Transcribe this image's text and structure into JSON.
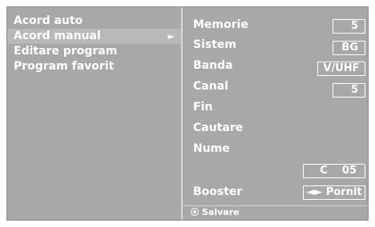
{
  "left_menu": {
    "items": [
      {
        "label": "Acord auto"
      },
      {
        "label": "Acord manual",
        "selected": true,
        "arrow": "►"
      },
      {
        "label": "Editare program"
      },
      {
        "label": "Program favorit"
      }
    ]
  },
  "settings": {
    "memorie": {
      "label": "Memorie",
      "value": "5"
    },
    "sistem": {
      "label": "Sistem",
      "value": "BG"
    },
    "banda": {
      "label": "Banda",
      "value": "V/UHF"
    },
    "canal": {
      "label": "Canal",
      "value": "5"
    },
    "fin": {
      "label": "Fin"
    },
    "cautare": {
      "label": "Cautare"
    },
    "nume": {
      "label": "Nume",
      "value": "C    05"
    },
    "booster": {
      "label": "Booster",
      "value": "◄► Pornit"
    }
  },
  "footer": {
    "label": "Salvare",
    "icon": "radio-dot-icon"
  },
  "colors": {
    "panel": "#a8a8a8",
    "highlight": "#b8b8b8",
    "text": "#ffffff",
    "divider": "#d6d6d6"
  }
}
